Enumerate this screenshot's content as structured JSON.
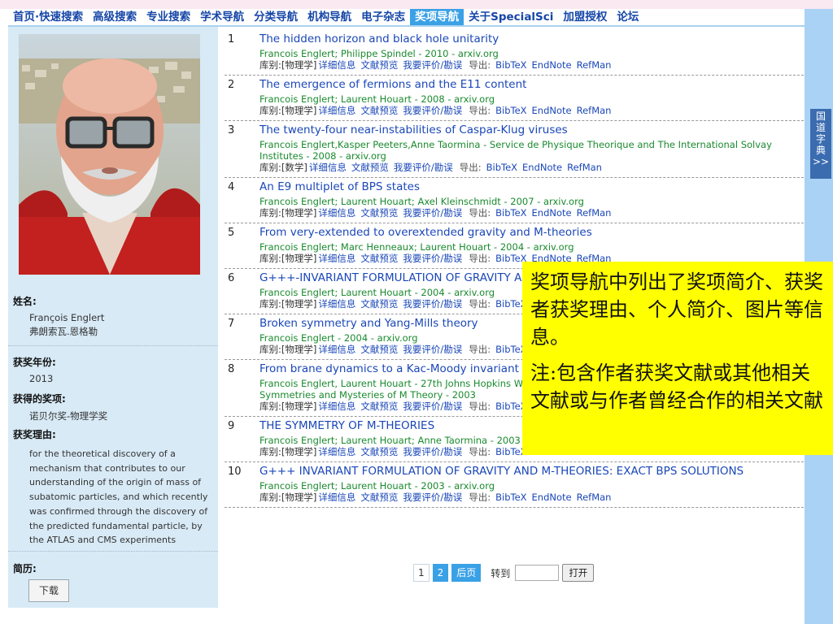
{
  "nav": {
    "items": [
      "首页·快速搜索",
      "高级搜索",
      "专业搜索",
      "学术导航",
      "分类导航",
      "机构导航",
      "电子杂志",
      "奖项导航",
      "关于SpecialSci",
      "加盟授权",
      "论坛"
    ],
    "active_index": 7
  },
  "dict_tab": {
    "label": "国道字典",
    "arrow": ">>"
  },
  "sidebar": {
    "name_label": "姓名:",
    "name_en": "François Englert",
    "name_zh": "弗朗索瓦.恩格勒",
    "year_label": "获奖年份:",
    "year": "2013",
    "award_label": "获得的奖项:",
    "award": "诺贝尔奖-物理学奖",
    "reason_label": "获奖理由:",
    "reason": "for the theoretical discovery of a mechanism that contributes to our understanding of the origin of mass of subatomic particles, and which recently was confirmed through the discovery of the predicted fundamental particle, by the ATLAS and CMS experiments",
    "cv_label": "简历:",
    "download_label": "下载"
  },
  "entry_ui": {
    "category_prefix": "库别:",
    "detail": "详细信息",
    "preview": "文献预览",
    "review": "我要评价/勘误",
    "export": "导出:",
    "bibtex": "BibTeX",
    "endnote": "EndNote",
    "refman": "RefMan"
  },
  "results": [
    {
      "num": "1",
      "title": "The hidden horizon and black hole unitarity",
      "authors": "Francois Englert; Philippe Spindel - 2010 - arxiv.org",
      "category": "[物理学]"
    },
    {
      "num": "2",
      "title": "The emergence of fermions and the E11 content",
      "authors": "Francois Englert; Laurent Houart - 2008 - arxiv.org",
      "category": "[物理学]"
    },
    {
      "num": "3",
      "title": "The twenty-four near-instabilities of Caspar-Klug viruses",
      "authors": "Francois Englert,Kasper Peeters,Anne Taormina - Service de Physique Theorique and The International Solvay Institutes - 2008 - arxiv.org",
      "category": "[数学]"
    },
    {
      "num": "4",
      "title": "An E9 multiplet of BPS states",
      "authors": "Francois Englert; Laurent Houart; Axel Kleinschmidt - 2007 - arxiv.org",
      "category": "[物理学]"
    },
    {
      "num": "5",
      "title": "From very-extended to overextended gravity and M-theories",
      "authors": "Francois Englert; Marc Henneaux; Laurent Houart - 2004 - arxiv.org",
      "category": "[物理学]"
    },
    {
      "num": "6",
      "title": "G+++-INVARIANT FORMULATION OF GRAVITY AND M-THEORIES: EXACT BPS BRANE SOLUTIONS",
      "authors": "Francois Englert; Laurent Houart - 2004 - arxiv.org",
      "category": "[物理学]"
    },
    {
      "num": "7",
      "title": "Broken symmetry and Yang-Mills theory",
      "authors": "Francois Englert - 2004 - arxiv.org",
      "category": "[物理学]"
    },
    {
      "num": "8",
      "title": "From brane dynamics to a Kac-Moody invariant formulation of M-theories",
      "authors": "Francois Englert, Laurent Houart - 27th Johns Hopkins Workshop on Current Problems in Particle Theory: Symmetries and Mysteries of M Theory - 2003",
      "category": "[物理学]"
    },
    {
      "num": "9",
      "title": "THE SYMMETRY OF M-THEORIES",
      "authors": "Francois Englert; Laurent Houart; Anne Taormina - 2003 - arxiv.org",
      "category": "[物理学]"
    },
    {
      "num": "10",
      "title": "G+++ INVARIANT FORMULATION OF GRAVITY AND M-THEORIES: EXACT BPS SOLUTIONS",
      "authors": "Francois Englert; Laurent Houart - 2003 - arxiv.org",
      "category": "[物理学]"
    }
  ],
  "pager": {
    "pages": [
      "1",
      "2"
    ],
    "current": "2",
    "next": "后页",
    "goto_label": "转到",
    "goto_value": "",
    "open_label": "打开"
  },
  "callout": {
    "text1": "奖项导航中列出了奖项简介、获奖者获奖理由、个人简介、图片等信息。",
    "text2": "注:包含作者获奖文献或其他相关文献或与作者曾经合作的相关文献"
  }
}
